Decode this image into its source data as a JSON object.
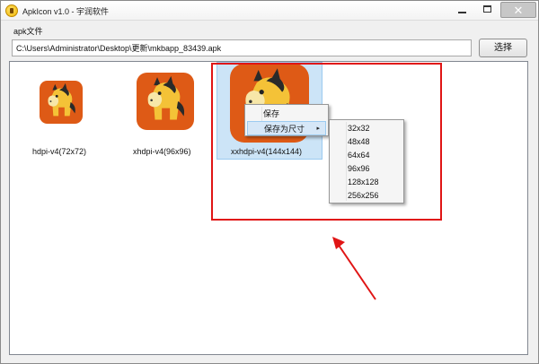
{
  "window": {
    "title": "ApkIcon v1.0 - 宇润软件",
    "minimize_symbol": "",
    "maximize_symbol": "",
    "close_symbol": "✕"
  },
  "menu": {
    "label": "apk文件"
  },
  "path": {
    "value": "C:\\Users\\Administrator\\Desktop\\更新\\mkbapp_83439.apk",
    "button_label": "选择"
  },
  "icons": [
    {
      "label": "hdpi-v4(72x72)"
    },
    {
      "label": "xhdpi-v4(96x96)"
    },
    {
      "label": "xxhdpi-v4(144x144)",
      "selected": true
    }
  ],
  "context_menu": {
    "items": [
      {
        "label": "保存"
      },
      {
        "label": "保存为尺寸",
        "arrow": "▸",
        "highlighted": true
      }
    ]
  },
  "submenu": {
    "items": [
      {
        "label": "32x32"
      },
      {
        "label": "48x48"
      },
      {
        "label": "64x64"
      },
      {
        "label": "96x96"
      },
      {
        "label": "128x128"
      },
      {
        "label": "256x256"
      }
    ]
  },
  "colors": {
    "tile": "#de5a16",
    "annotation": "#e01515",
    "selection": "#cce4f7"
  }
}
